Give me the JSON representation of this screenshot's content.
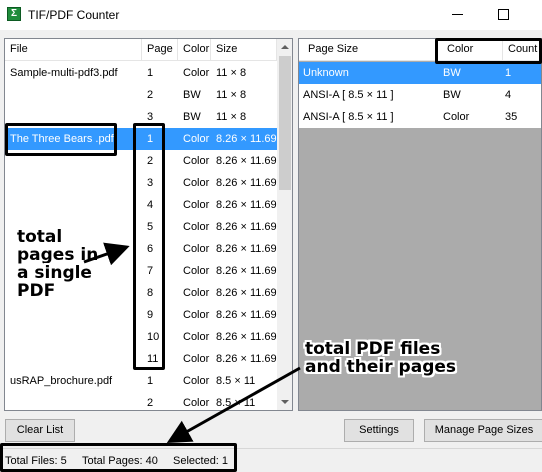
{
  "window": {
    "title": "TIF/PDF Counter",
    "icon": "sigma-app-icon"
  },
  "files_table": {
    "columns": [
      "File",
      "Page",
      "Color",
      "Size"
    ],
    "rows": [
      {
        "file": "Sample-multi-pdf3.pdf",
        "page": "1",
        "color": "Color",
        "size": "11 × 8"
      },
      {
        "file": "",
        "page": "2",
        "color": "BW",
        "size": "11 × 8"
      },
      {
        "file": "",
        "page": "3",
        "color": "BW",
        "size": "11 × 8"
      },
      {
        "file": "The Three Bears .pdf",
        "page": "1",
        "color": "Color",
        "size": "8.26 × 11.69"
      },
      {
        "file": "",
        "page": "2",
        "color": "Color",
        "size": "8.26 × 11.69"
      },
      {
        "file": "",
        "page": "3",
        "color": "Color",
        "size": "8.26 × 11.69"
      },
      {
        "file": "",
        "page": "4",
        "color": "Color",
        "size": "8.26 × 11.69"
      },
      {
        "file": "",
        "page": "5",
        "color": "Color",
        "size": "8.26 × 11.69"
      },
      {
        "file": "",
        "page": "6",
        "color": "Color",
        "size": "8.26 × 11.69"
      },
      {
        "file": "",
        "page": "7",
        "color": "Color",
        "size": "8.26 × 11.69"
      },
      {
        "file": "",
        "page": "8",
        "color": "Color",
        "size": "8.26 × 11.69"
      },
      {
        "file": "",
        "page": "9",
        "color": "Color",
        "size": "8.26 × 11.69"
      },
      {
        "file": "",
        "page": "10",
        "color": "Color",
        "size": "8.26 × 11.69"
      },
      {
        "file": "",
        "page": "11",
        "color": "Color",
        "size": "8.26 × 11.69"
      },
      {
        "file": "usRAP_brochure.pdf",
        "page": "1",
        "color": "Color",
        "size": "8.5 × 11"
      },
      {
        "file": "",
        "page": "2",
        "color": "Color",
        "size": "8.5 × 11"
      }
    ],
    "selected_row": 3
  },
  "summary_table": {
    "columns": [
      "Page Size",
      "Color",
      "Count"
    ],
    "rows": [
      {
        "size": "Unknown",
        "color": "BW",
        "count": "1"
      },
      {
        "size": "ANSI-A [ 8.5 × 11 ]",
        "color": "BW",
        "count": "4"
      },
      {
        "size": "ANSI-A [ 8.5 × 11 ]",
        "color": "Color",
        "count": "35"
      }
    ],
    "selected_row": 0
  },
  "buttons": {
    "clear_list": "Clear List",
    "settings": "Settings",
    "manage_page_sizes": "Manage Page Sizes"
  },
  "status": {
    "total_files": "Total Files: 5",
    "total_pages": "Total Pages: 40",
    "selected": "Selected: 1"
  },
  "annotations": {
    "single_pdf_note": "total pages in a single PDF",
    "files_note": "total PDF files and their pages"
  },
  "colors": {
    "selection": "#3399ff",
    "right_panel_bg": "#ababab",
    "app_icon": "#1f8c3b"
  }
}
